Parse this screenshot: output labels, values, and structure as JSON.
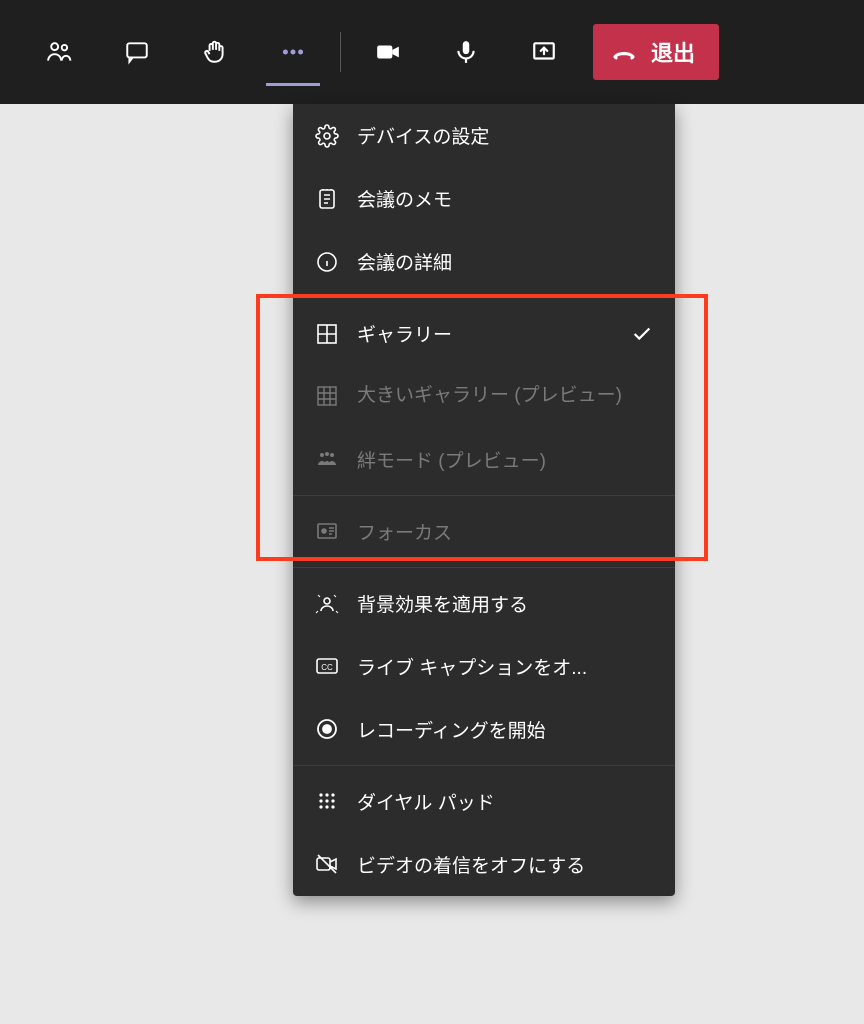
{
  "toolbar": {
    "leave_label": "退出"
  },
  "menu": {
    "device_settings": "デバイスの設定",
    "meeting_notes": "会議のメモ",
    "meeting_details": "会議の詳細",
    "gallery": "ギャラリー",
    "large_gallery": "大きいギャラリー (プレビュー)",
    "together_mode": "絆モード (プレビュー)",
    "focus": "フォーカス",
    "background_effects": "背景効果を適用する",
    "live_captions": "ライブ キャプションをオ...",
    "start_recording": "レコーディングを開始",
    "dial_pad": "ダイヤル パッド",
    "incoming_video_off": "ビデオの着信をオフにする"
  }
}
